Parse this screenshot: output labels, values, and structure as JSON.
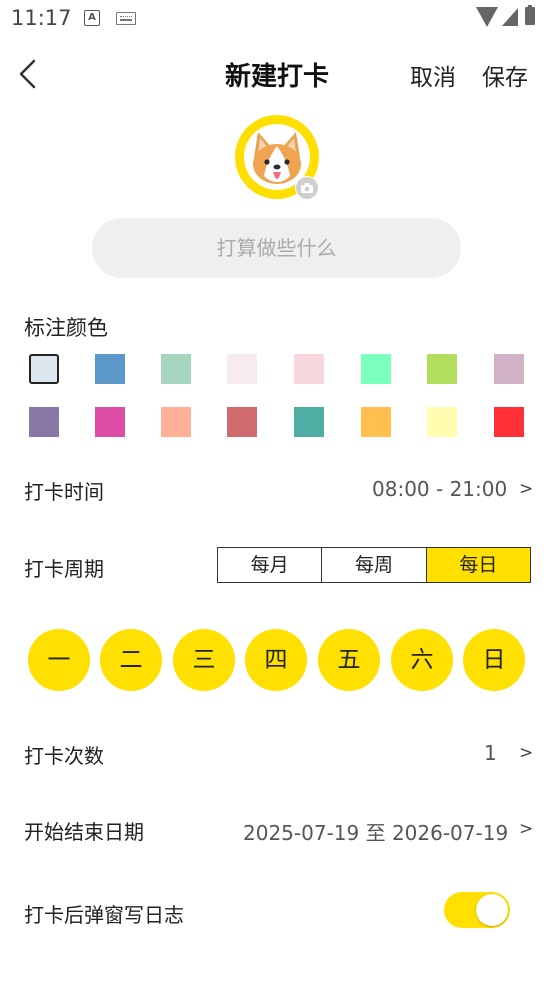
{
  "status_bar": {
    "time": "11:17",
    "a_icon_label": "A"
  },
  "header": {
    "title": "新建打卡",
    "cancel_label": "取消",
    "save_label": "保存"
  },
  "avatar": {
    "description_icon": "corgi-avatar-icon",
    "ring_color": "#FFDF00"
  },
  "name_field": {
    "placeholder": "打算做些什么",
    "value": ""
  },
  "color_section": {
    "label": "标注颜色",
    "selected_index": 0,
    "colors": [
      "#DCE6EE",
      "#5B9AC8",
      "#A6D4BC",
      "#F8EBEF",
      "#F7D8DE",
      "#7AFFBC",
      "#B2DE5E",
      "#D1B1C6",
      "#8878A8",
      "#DE4EA6",
      "#FFB096",
      "#CF6A6E",
      "#4EAEA1",
      "#FFC050",
      "#FFFEB0",
      "#FF3036"
    ]
  },
  "time_row": {
    "label": "打卡时间",
    "value": "08:00 - 21:00",
    "chevron": ">"
  },
  "period_row": {
    "label": "打卡周期",
    "options": [
      "每月",
      "每周",
      "每日"
    ],
    "selected": "每日"
  },
  "weekdays": [
    "一",
    "二",
    "三",
    "四",
    "五",
    "六",
    "日"
  ],
  "count_row": {
    "label": "打卡次数",
    "value": "1",
    "chevron": ">"
  },
  "date_row": {
    "label": "开始结束日期",
    "value": "2025-07-19 至 2026-07-19",
    "chevron": ">"
  },
  "journal_row": {
    "label": "打卡后弹窗写日志",
    "enabled": true
  },
  "accent_color": "#FFE000"
}
